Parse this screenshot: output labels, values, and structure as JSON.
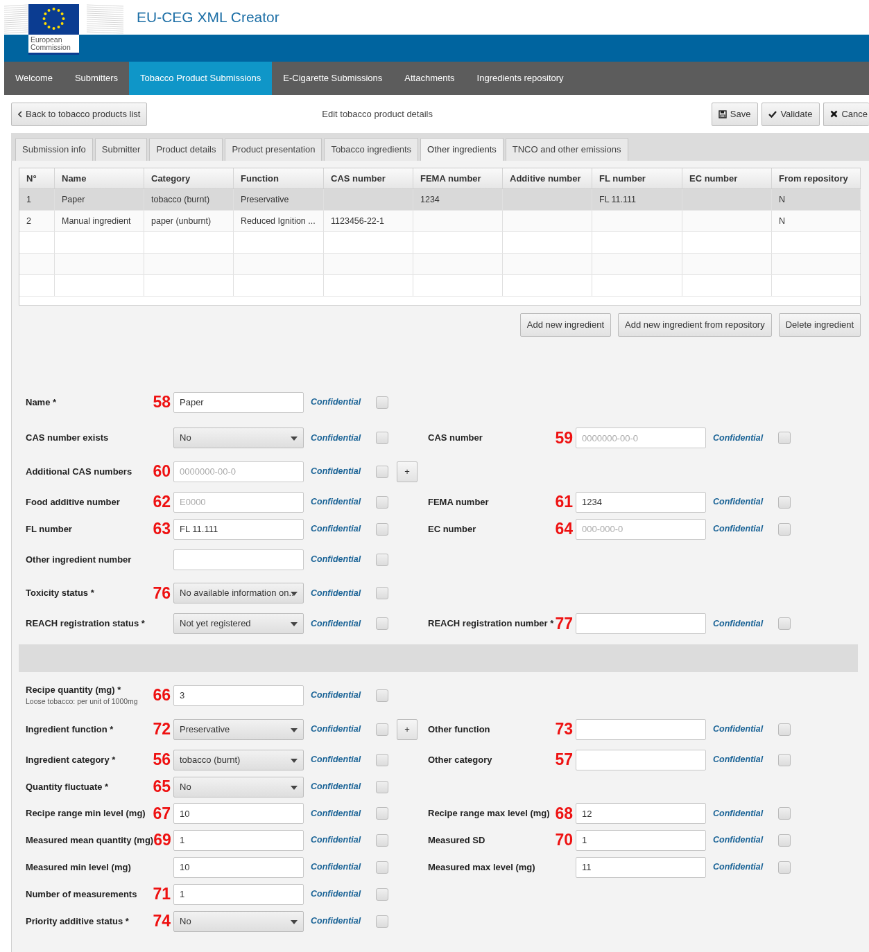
{
  "header": {
    "title": "EU-CEG XML Creator",
    "logo_text": "European Commission"
  },
  "nav": [
    {
      "label": "Welcome",
      "selected": false
    },
    {
      "label": "Submitters",
      "selected": false
    },
    {
      "label": "Tobacco Product Submissions",
      "selected": true
    },
    {
      "label": "E-Cigarette Submissions",
      "selected": false
    },
    {
      "label": "Attachments",
      "selected": false
    },
    {
      "label": "Ingredients repository",
      "selected": false
    }
  ],
  "toolbar": {
    "back_button": "Back to tobacco products list",
    "title": "Edit tobacco product details",
    "buttons": [
      {
        "kind": "save",
        "label": "Save"
      },
      {
        "kind": "validate",
        "label": "Validate"
      },
      {
        "kind": "cancel",
        "label": "Cance"
      }
    ]
  },
  "tabs": [
    {
      "label": "Submission info",
      "selected": false
    },
    {
      "label": "Submitter",
      "selected": false
    },
    {
      "label": "Product details",
      "selected": false
    },
    {
      "label": "Product presentation",
      "selected": false
    },
    {
      "label": "Tobacco ingredients",
      "selected": false
    },
    {
      "label": "Other ingredients",
      "selected": true
    },
    {
      "label": "TNCO and other emissions",
      "selected": false
    }
  ],
  "table": {
    "columns": [
      "N°",
      "Name",
      "Category",
      "Function",
      "CAS number",
      "FEMA number",
      "Additive number",
      "FL number",
      "EC number",
      "From repository"
    ],
    "rows": [
      {
        "selected": true,
        "cells": [
          "1",
          "Paper",
          "tobacco (burnt)",
          "Preservative",
          null,
          "1234",
          null,
          "FL 11.111",
          null,
          "N"
        ]
      },
      {
        "selected": false,
        "cells": [
          "2",
          "Manual ingredient",
          "paper (unburnt)",
          "Reduced Ignition ...",
          "1123456-22-1",
          null,
          null,
          null,
          null,
          "N"
        ]
      }
    ]
  },
  "table_buttons": [
    "Add new ingredient",
    "Add new ingredient from repository",
    "Delete ingredient"
  ],
  "sections": [
    {
      "rows": [
        {
          "left": {
            "label": "Name *",
            "annotation": "58",
            "kind": "text",
            "value": "Paper",
            "confidential": "Confidential",
            "checked": false
          }
        },
        {
          "left": {
            "label": "CAS number exists",
            "kind": "select",
            "value": "No",
            "confidential": "Confidential",
            "checked": false
          },
          "right": {
            "label": "CAS number",
            "annotation": "59",
            "kind": "text",
            "placeholder": "0000000-00-0",
            "confidential": "Confidential",
            "checked": false
          }
        },
        {
          "left": {
            "label": "Additional CAS numbers",
            "annotation": "60",
            "kind": "text",
            "placeholder": "0000000-00-0",
            "confidential": "Confidential",
            "checked": false,
            "add_button": "+"
          }
        },
        {
          "left": {
            "label": "Food additive number",
            "annotation": "62",
            "kind": "text",
            "placeholder": "E0000",
            "confidential": "Confidential",
            "checked": false
          },
          "right": {
            "label": "FEMA number",
            "annotation": "61",
            "kind": "text",
            "value": "1234",
            "confidential": "Confidential",
            "checked": false
          }
        },
        {
          "left": {
            "label": "FL number",
            "annotation": "63",
            "kind": "text",
            "value": "FL 11.111",
            "confidential": "Confidential",
            "checked": false
          },
          "right": {
            "label": "EC number",
            "annotation": "64",
            "kind": "text",
            "placeholder": "000-000-0",
            "confidential": "Confidential",
            "checked": false
          }
        },
        {
          "left": {
            "label": "Other ingredient number",
            "kind": "text",
            "confidential": "Confidential",
            "checked": false
          }
        },
        {
          "left": {
            "label": "Toxicity status *",
            "annotation": "76",
            "kind": "select",
            "value": "No available information on..",
            "confidential": "Confidential",
            "checked": false
          }
        },
        {
          "left": {
            "label": "REACH registration status *",
            "kind": "select",
            "value": "Not yet registered",
            "confidential": "Confidential",
            "checked": false
          },
          "right": {
            "label": "REACH registration number *",
            "annotation": "77",
            "kind": "text",
            "confidential": "Confidential",
            "checked": false
          }
        }
      ]
    },
    {
      "rows": [
        {
          "left": {
            "label": "Recipe quantity (mg) *",
            "note": "Loose tobacco: per unit of 1000mg",
            "annotation": "66",
            "kind": "text",
            "value": "3",
            "confidential": "Confidential",
            "checked": false
          }
        },
        {
          "left": {
            "label": "Ingredient function *",
            "annotation": "72",
            "kind": "select",
            "value": "Preservative",
            "confidential": "Confidential",
            "checked": false,
            "add_button": "+"
          },
          "right": {
            "label": "Other function",
            "annotation": "73",
            "kind": "text",
            "confidential": "Confidential",
            "checked": false
          }
        },
        {
          "left": {
            "label": "Ingredient category *",
            "annotation": "56",
            "kind": "select",
            "value": "tobacco (burnt)",
            "confidential": "Confidential",
            "checked": false
          },
          "right": {
            "label": "Other category",
            "annotation": "57",
            "kind": "text",
            "confidential": "Confidential",
            "checked": false
          }
        },
        {
          "left": {
            "label": "Quantity fluctuate *",
            "annotation": "65",
            "kind": "select",
            "value": "No",
            "confidential": "Confidential",
            "checked": false
          }
        },
        {
          "left": {
            "label": "Recipe range min level (mg)",
            "annotation": "67",
            "kind": "text",
            "value": "10",
            "confidential": "Confidential",
            "checked": false
          },
          "right": {
            "label": "Recipe range max level (mg)",
            "annotation": "68",
            "kind": "text",
            "value": "12",
            "confidential": "Confidential",
            "checked": false
          }
        },
        {
          "left": {
            "label": "Measured mean quantity (mg)",
            "annotation": "69",
            "kind": "text",
            "value": "1",
            "confidential": "Confidential",
            "checked": false
          },
          "right": {
            "label": "Measured SD",
            "annotation": "70",
            "kind": "text",
            "value": "1",
            "confidential": "Confidential",
            "checked": false
          }
        },
        {
          "left": {
            "label": "Measured min level (mg)",
            "kind": "text",
            "value": "10",
            "confidential": "Confidential",
            "checked": false
          },
          "right": {
            "label": "Measured max level (mg)",
            "kind": "text",
            "value": "11",
            "confidential": "Confidential",
            "checked": false
          }
        },
        {
          "left": {
            "label": "Number of measurements",
            "annotation": "71",
            "kind": "text",
            "value": "1",
            "confidential": "Confidential",
            "checked": false
          }
        },
        {
          "left": {
            "label": "Priority additive status *",
            "annotation": "74",
            "kind": "select",
            "value": "No",
            "confidential": "Confidential",
            "checked": false
          }
        }
      ]
    }
  ]
}
